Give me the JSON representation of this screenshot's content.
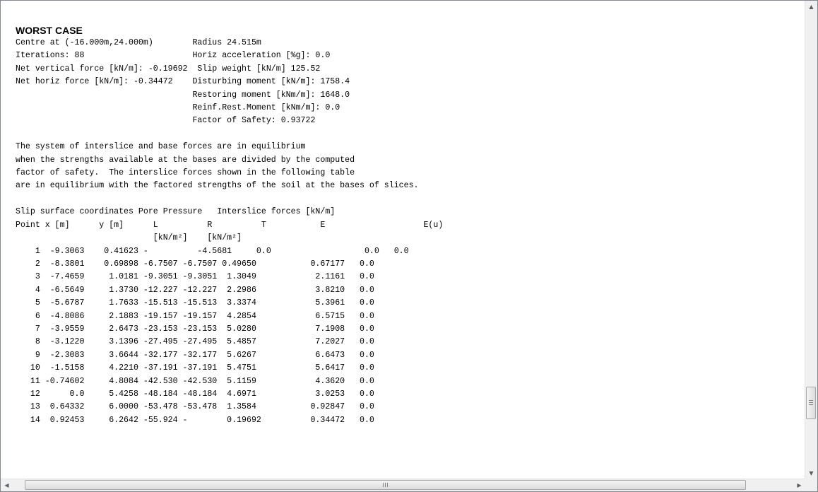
{
  "report": {
    "heading": "WORST CASE",
    "summary_lines": [
      "Centre at (-16.000m,24.000m)        Radius 24.515m",
      "Iterations: 88                      Horiz acceleration [%g]: 0.0",
      "Net vertical force [kN/m]: -0.19692  Slip weight [kN/m] 125.52",
      "Net horiz force [kN/m]: -0.34472    Disturbing moment [kN/m]: 1758.4",
      "                                    Restoring moment [kNm/m]: 1648.0",
      "                                    Reinf.Rest.Moment [kNm/m]: 0.0",
      "                                    Factor of Safety: 0.93722"
    ],
    "paragraph_lines": [
      "The system of interslice and base forces are in equilibrium",
      "when the strengths available at the bases are divided by the computed",
      "factor of safety.  The interslice forces shown in the following table",
      "are in equilibrium with the factored strengths of the soil at the bases of slices."
    ],
    "table_header_lines": [
      "Slip surface coordinates Pore Pressure   Interslice forces [kN/m]",
      "Point x [m]      y [m]      L          R          T           E                    E(u)",
      "                            [kN/m²]    [kN/m²]"
    ],
    "table_rows": [
      "    1  -9.3063    0.41623 -          -4.5681     0.0                   0.0   0.0",
      "    2  -8.3801    0.69898 -6.7507 -6.7507 0.49650           0.67177   0.0",
      "    3  -7.4659     1.0181 -9.3051 -9.3051  1.3049            2.1161   0.0",
      "    4  -6.5649     1.3730 -12.227 -12.227  2.2986            3.8210   0.0",
      "    5  -5.6787     1.7633 -15.513 -15.513  3.3374            5.3961   0.0",
      "    6  -4.8086     2.1883 -19.157 -19.157  4.2854            6.5715   0.0",
      "    7  -3.9559     2.6473 -23.153 -23.153  5.0280            7.1908   0.0",
      "    8  -3.1220     3.1396 -27.495 -27.495  5.4857            7.2027   0.0",
      "    9  -2.3083     3.6644 -32.177 -32.177  5.6267            6.6473   0.0",
      "   10  -1.5158     4.2210 -37.191 -37.191  5.4751            5.6417   0.0",
      "   11 -0.74602     4.8084 -42.530 -42.530  5.1159            4.3620   0.0",
      "   12      0.0     5.4258 -48.184 -48.184  4.6971            3.0253   0.0",
      "   13  0.64332     6.0000 -53.478 -53.478  1.3584           0.92847   0.0",
      "   14  0.92453     6.2642 -55.924 -        0.19692          0.34472   0.0"
    ]
  },
  "scrollbars": {
    "up_arrow": "▲",
    "down_arrow": "▼",
    "left_arrow": "◀",
    "right_arrow": "▶"
  }
}
